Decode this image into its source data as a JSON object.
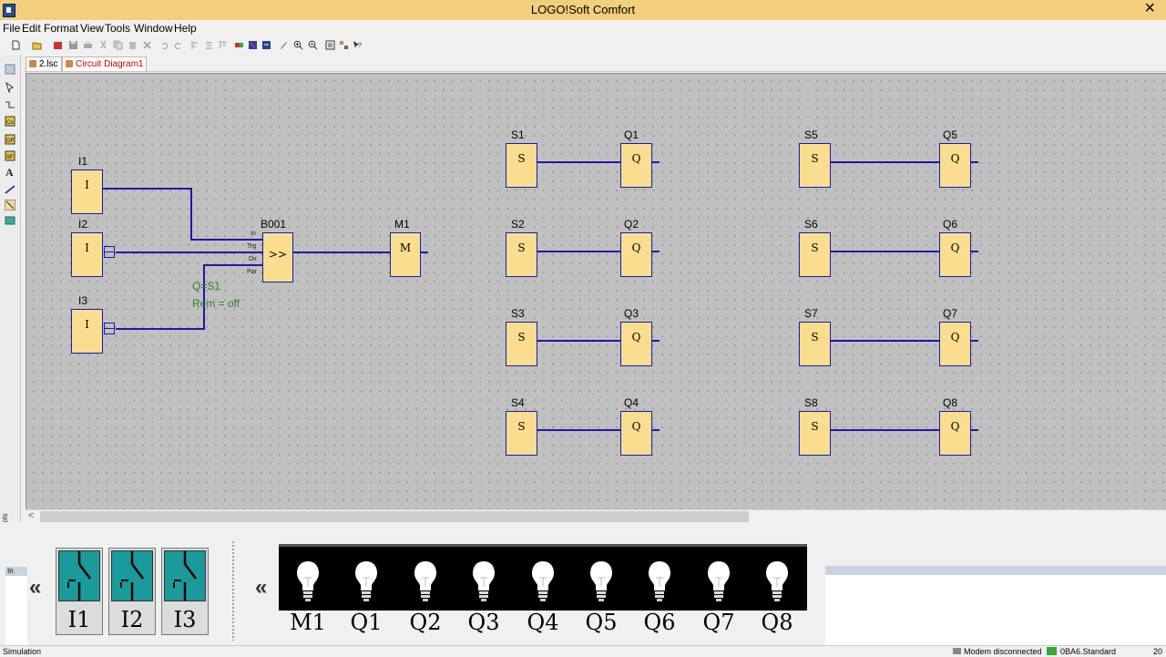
{
  "app": {
    "title": "LOGO!Soft Comfort"
  },
  "menu": [
    "File",
    "Edit",
    "Format",
    "View",
    "Tools",
    "Window",
    "Help"
  ],
  "tabs": [
    {
      "label": "2.lsc",
      "active": false
    },
    {
      "label": "Circuit Diagram1",
      "active": true
    }
  ],
  "diagram": {
    "inputs": [
      {
        "label": "I1",
        "symbol": "I"
      },
      {
        "label": "I2",
        "symbol": "I"
      },
      {
        "label": "I3",
        "symbol": "I"
      }
    ],
    "counter": {
      "label": "B001",
      "symbol": ">>",
      "pins": [
        "In",
        "Trg",
        "Dir",
        "Par"
      ],
      "param_line1": "Q=S1",
      "param_line2": "Rem = off"
    },
    "marker": {
      "label": "M1",
      "symbol": "M"
    },
    "flags": [
      {
        "label": "S1",
        "symbol": "S"
      },
      {
        "label": "S2",
        "symbol": "S"
      },
      {
        "label": "S3",
        "symbol": "S"
      },
      {
        "label": "S4",
        "symbol": "S"
      },
      {
        "label": "S5",
        "symbol": "S"
      },
      {
        "label": "S6",
        "symbol": "S"
      },
      {
        "label": "S7",
        "symbol": "S"
      },
      {
        "label": "S8",
        "symbol": "S"
      }
    ],
    "outputs": [
      {
        "label": "Q1",
        "symbol": "Q"
      },
      {
        "label": "Q2",
        "symbol": "Q"
      },
      {
        "label": "Q3",
        "symbol": "Q"
      },
      {
        "label": "Q4",
        "symbol": "Q"
      },
      {
        "label": "Q5",
        "symbol": "Q"
      },
      {
        "label": "Q6",
        "symbol": "Q"
      },
      {
        "label": "Q7",
        "symbol": "Q"
      },
      {
        "label": "Q8",
        "symbol": "Q"
      }
    ]
  },
  "simulation": {
    "collapse_symbol": "«",
    "switches": [
      "I1",
      "I2",
      "I3"
    ],
    "lamps": [
      "M1",
      "Q1",
      "Q2",
      "Q3",
      "Q4",
      "Q5",
      "Q6",
      "Q7",
      "Q8"
    ]
  },
  "side_panel": {
    "tools_label": "Tools",
    "info_label": "In"
  },
  "status": {
    "mode": "Simulation",
    "connection": "Modem disconnected",
    "device": "0BA6.Standard",
    "extra": "20"
  },
  "colors": {
    "block_fill": "#fbdd90",
    "wire": "#1a1aaa",
    "titlebar": "#f1cf7c",
    "switch": "#1a9a9a"
  }
}
